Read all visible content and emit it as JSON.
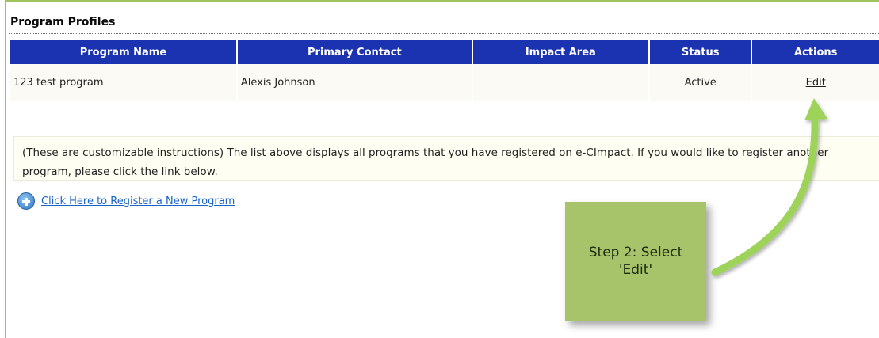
{
  "page": {
    "title": "Program Profiles"
  },
  "table": {
    "headers": [
      "Program Name",
      "Primary Contact",
      "Impact Area",
      "Status",
      "Actions"
    ],
    "rows": [
      {
        "program_name": "123 test program",
        "primary_contact": "Alexis Johnson",
        "impact_area": "",
        "status": "Active",
        "action": "Edit"
      }
    ]
  },
  "instructions": {
    "text": "(These are customizable instructions) The list above displays all programs that you have registered on e-CImpact. If you would like to register another program, please click the link below."
  },
  "register": {
    "icon": "plus-circle-icon",
    "label": "Click Here to Register a New Program"
  },
  "callout": {
    "text": "Step 2: Select\n'Edit'"
  },
  "colors": {
    "header_bg": "#1b33b0",
    "row_bg": "#fcfaf4",
    "frame_border": "#9dc35a",
    "callout_bg": "#a8c46b",
    "arrow": "#9ed35a",
    "link": "#1a63c6"
  }
}
